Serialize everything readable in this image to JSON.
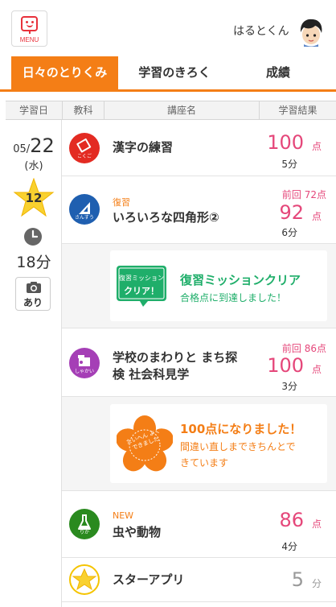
{
  "header": {
    "menu_label": "MENU",
    "username": "はるとくん"
  },
  "tabs": [
    {
      "label": "日々のとりくみ",
      "active": true
    },
    {
      "label": "学習のきろく",
      "active": false
    },
    {
      "label": "成績",
      "active": false
    }
  ],
  "columns": [
    "学習日",
    "教科",
    "講座名",
    "学習結果"
  ],
  "day": {
    "month": "05/",
    "day": "22",
    "weekday": "(水)",
    "star_count": "12",
    "study_time": "18分",
    "photo_label": "あり"
  },
  "rows": [
    {
      "subject_icon": "kokugo-icon",
      "subject_label": "こくご",
      "color": "#e32b22",
      "tag": "",
      "title": "漢字の練習",
      "prev": "",
      "score": "100",
      "unit": "点",
      "minutes": "5分"
    },
    {
      "subject_icon": "sansu-icon",
      "subject_label": "さんすう",
      "color": "#1f5fb0",
      "tag": "復習",
      "title": "いろいろな四角形②",
      "prev": "前回 72点",
      "score": "92",
      "unit": "点",
      "minutes": "6分"
    },
    {
      "subject_icon": "shakai-icon",
      "subject_label": "しゃかい",
      "color": "#a53fb6",
      "tag": "",
      "title_line1": "学校のまわりと まち探",
      "title_line2": "検 社会科見学",
      "prev": "前回 86点",
      "score": "100",
      "unit": "点",
      "minutes": "3分"
    },
    {
      "subject_icon": "rika-icon",
      "subject_label": "りか",
      "color": "#2a8a1f",
      "tag": "NEW",
      "title": "虫や動物",
      "prev": "",
      "score": "86",
      "unit": "点",
      "minutes": "4分"
    },
    {
      "subject_icon": "star-app-icon",
      "subject_label": "",
      "color": "#f5c400",
      "tag": "",
      "title": "スターアプリ",
      "prev": "",
      "score": "5",
      "unit": "分",
      "minutes": ""
    }
  ],
  "missions": [
    {
      "badge_line1": "復習ミッション",
      "badge_line2": "クリア！",
      "title": "復習ミッションクリア",
      "sub": "合格点に到達しました！",
      "color": "#1fae6a"
    },
    {
      "badge_text": "たいへん よくできました",
      "title": "100点になりました！",
      "sub_line1": "間違い直しまできちんとで",
      "sub_line2": "きています",
      "color": "#f47e16"
    }
  ],
  "colors": {
    "accent": "#f47e16",
    "score": "#e5477a",
    "mission_green": "#1fae6a",
    "menu_red": "#e8313b"
  }
}
